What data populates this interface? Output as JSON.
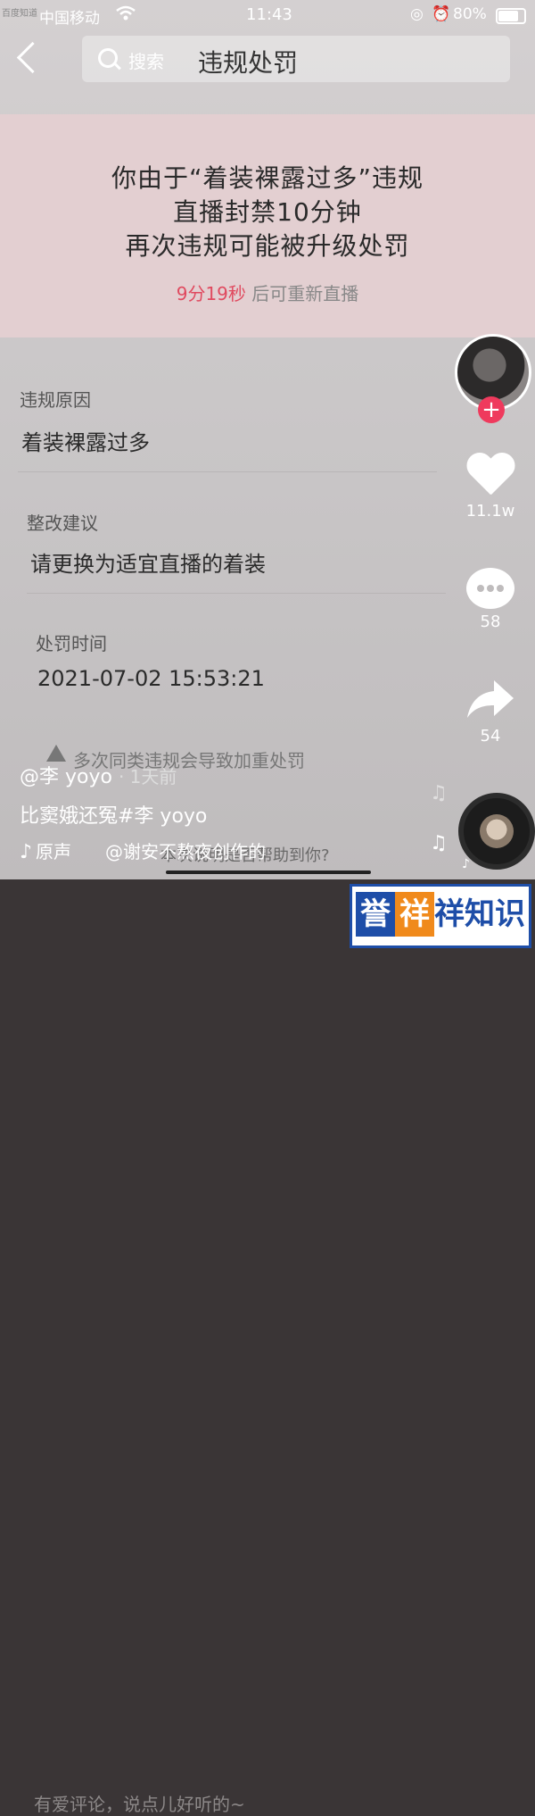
{
  "status_bar": {
    "watermark": "百度知道",
    "carrier": "中国移动",
    "time": "11:43",
    "battery": "80%"
  },
  "top_bar": {
    "search_placeholder": "搜索",
    "search_query": "违规处罚"
  },
  "banner": {
    "line1": "你由于“着装裸露过多”违规",
    "line2": "直播封禁10分钟",
    "line3": "再次违规可能被升级处罚",
    "countdown_time": "9分19秒",
    "countdown_rest": "后可重新直播"
  },
  "details": {
    "reason_label": "违规原因",
    "reason_value": "着装裸露过多",
    "advice_label": "整改建议",
    "advice_value": "请更换为适宜直播的着装",
    "time_label": "处罚时间",
    "time_value": "2021-07-02 15:53:21",
    "warning": "多次同类违规会导致加重处罚"
  },
  "side_actions": {
    "likes": "11.1w",
    "comments": "58",
    "shares": "54"
  },
  "post": {
    "author": "@李 yoyo",
    "ago": "· 1天前",
    "caption": "比窦娥还冤#李 yoyo",
    "music_label": "原声",
    "music_mention": "@谢安不熬夜创作的",
    "faded_text": "本次说明是否帮助到你?"
  },
  "comment_bar": {
    "placeholder": "有爱评论，说点儿好听的~"
  },
  "logo": {
    "part1": "誉",
    "part2": "祥",
    "part3": "祥知识"
  }
}
